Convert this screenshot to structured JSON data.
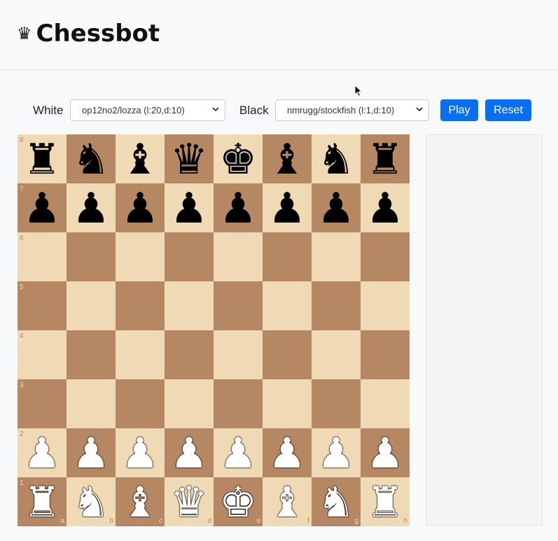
{
  "app": {
    "title": "Chessbot",
    "title_icon": "crown-icon",
    "title_glyph": "♛"
  },
  "controls": {
    "white_label": "White",
    "white_engine": "op12no2/lozza (l:20,d:10)",
    "black_label": "Black",
    "black_engine": "nmrugg/stockfish (l:1,d:10)",
    "play_label": "Play",
    "reset_label": "Reset"
  },
  "colors": {
    "accent": "#0a6ef0",
    "light_square": "#f0d9b5",
    "dark_square": "#b58863"
  },
  "board": {
    "files": [
      "a",
      "b",
      "c",
      "d",
      "e",
      "f",
      "g",
      "h"
    ],
    "ranks": [
      "8",
      "7",
      "6",
      "5",
      "4",
      "3",
      "2",
      "1"
    ],
    "position": [
      [
        "bR",
        "bN",
        "bB",
        "bQ",
        "bK",
        "bB",
        "bN",
        "bR"
      ],
      [
        "bP",
        "bP",
        "bP",
        "bP",
        "bP",
        "bP",
        "bP",
        "bP"
      ],
      [
        "",
        "",
        "",
        "",
        "",
        "",
        "",
        ""
      ],
      [
        "",
        "",
        "",
        "",
        "",
        "",
        "",
        ""
      ],
      [
        "",
        "",
        "",
        "",
        "",
        "",
        "",
        ""
      ],
      [
        "",
        "",
        "",
        "",
        "",
        "",
        "",
        ""
      ],
      [
        "wP",
        "wP",
        "wP",
        "wP",
        "wP",
        "wP",
        "wP",
        "wP"
      ],
      [
        "wR",
        "wN",
        "wB",
        "wQ",
        "wK",
        "wB",
        "wN",
        "wR"
      ]
    ]
  },
  "move_panel": {
    "moves": []
  }
}
